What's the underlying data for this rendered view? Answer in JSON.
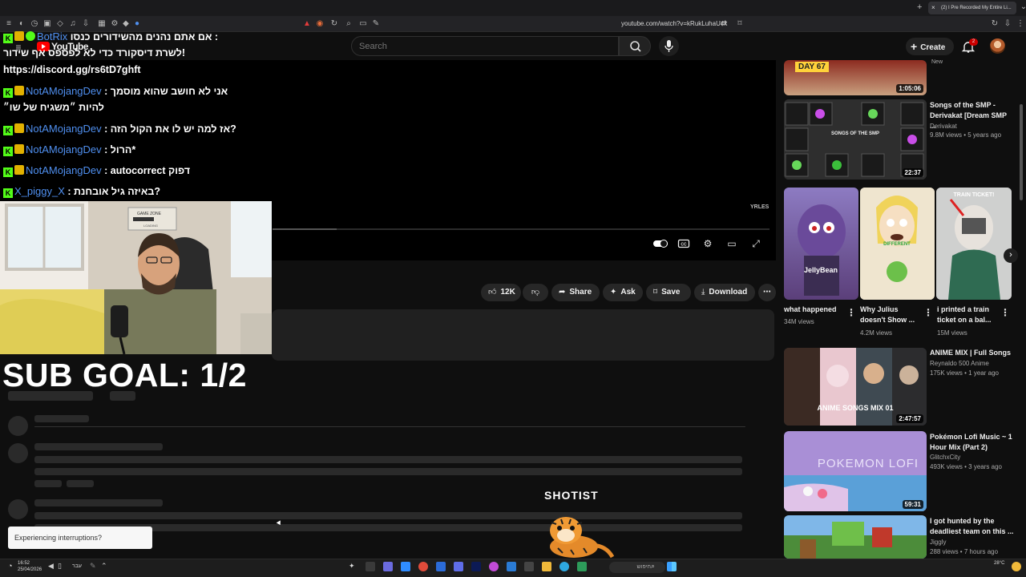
{
  "browser": {
    "tab_title": "(2) I Pre Recorded My Entire Li...",
    "url": "youtube.com/watch?v=kRukLuhaU4k"
  },
  "youtube": {
    "logo_text": "YouTube",
    "search_placeholder": "Search",
    "create_label": "Create",
    "notification_count": "2",
    "likes": "12K",
    "share_label": "Share",
    "ask_label": "Ask",
    "save_label": "Save",
    "download_label": "Download"
  },
  "chat": [
    {
      "name": "BotRix",
      "message": "אם אתם נהנים מהשידורים כנסו :",
      "badges": [
        "kick",
        "sub",
        "verified"
      ]
    },
    {
      "name": "",
      "message": "לשרת דיסקורד כדי לא לפספס אף שידור!",
      "badges": []
    },
    {
      "name": "",
      "message": "https://discord.gg/rs6tD7ghft",
      "badges": []
    },
    {
      "name": "NotAMojangDev",
      "message": ": אני לא חושב שהוא מוסמך",
      "badges": [
        "kick",
        "sub"
      ]
    },
    {
      "name": "",
      "message": "להיות ״משגיח של שו״",
      "badges": []
    },
    {
      "name": "NotAMojangDev",
      "message": ": אז למה יש לו את הקול הזה?",
      "badges": [
        "kick",
        "sub"
      ]
    },
    {
      "name": "NotAMojangDev",
      "message": ": הרול*",
      "badges": [
        "kick",
        "sub"
      ]
    },
    {
      "name": "NotAMojangDev",
      "message": ": autocorrect דפוק",
      "badges": [
        "kick",
        "sub"
      ]
    },
    {
      "name": "X_piggy_X",
      "message": ": באיזה גיל אובחנת?",
      "badges": [
        "kick"
      ]
    }
  ],
  "overlay": {
    "sub_goal": "SUB GOAL: 1/2",
    "streamer_name": "SHOTIST",
    "interrupt_text": "Experiencing interruptions?",
    "game_zone": "GAME ZONE",
    "loading": "LOADING"
  },
  "sidebar": {
    "videos": [
      {
        "duration": "1:05:06",
        "badge": "New",
        "thumb_text": "DAY 67"
      },
      {
        "title": "Songs of the SMP - Derivakat [Dream SMP ...",
        "channel": "Derivakat",
        "stats": "9.8M views • 5 years ago",
        "duration": "22:37",
        "thumb_text": "SONGS OF THE SMP"
      },
      {
        "title": "ANIME MIX | Full Songs",
        "channel": "Reynaldo 500 Anime",
        "stats": "175K views • 1 year ago",
        "duration": "2:47:57",
        "thumb_text": "ANIME SONGS MIX 01"
      },
      {
        "title": "Pokémon Lofi Music ~ 1 Hour Mix (Part 2)",
        "channel": "GlitchxCity",
        "stats": "493K views • 3 years ago",
        "duration": "59:31",
        "thumb_text": "POKEMON LOFI"
      },
      {
        "title": "I got hunted by the deadliest team on this ...",
        "channel": "Jiggly",
        "stats": "288 views • 7 hours ago"
      }
    ],
    "shorts": [
      {
        "title": "what happened",
        "views": "34M views",
        "thumb_text": "JellyBean"
      },
      {
        "title": "Why Julius doesn't Show ...",
        "views": "4.2M views",
        "thumb_text": "DIFFERENT"
      },
      {
        "title": "i printed a train ticket on a bal...",
        "views": "15M views",
        "thumb_text": "TRAIN TICKET!"
      }
    ]
  },
  "taskbar": {
    "time": "16:52",
    "date": "25/04/2026",
    "lang": "עבר",
    "search_label": "חיפוש",
    "weather": "28°C"
  }
}
